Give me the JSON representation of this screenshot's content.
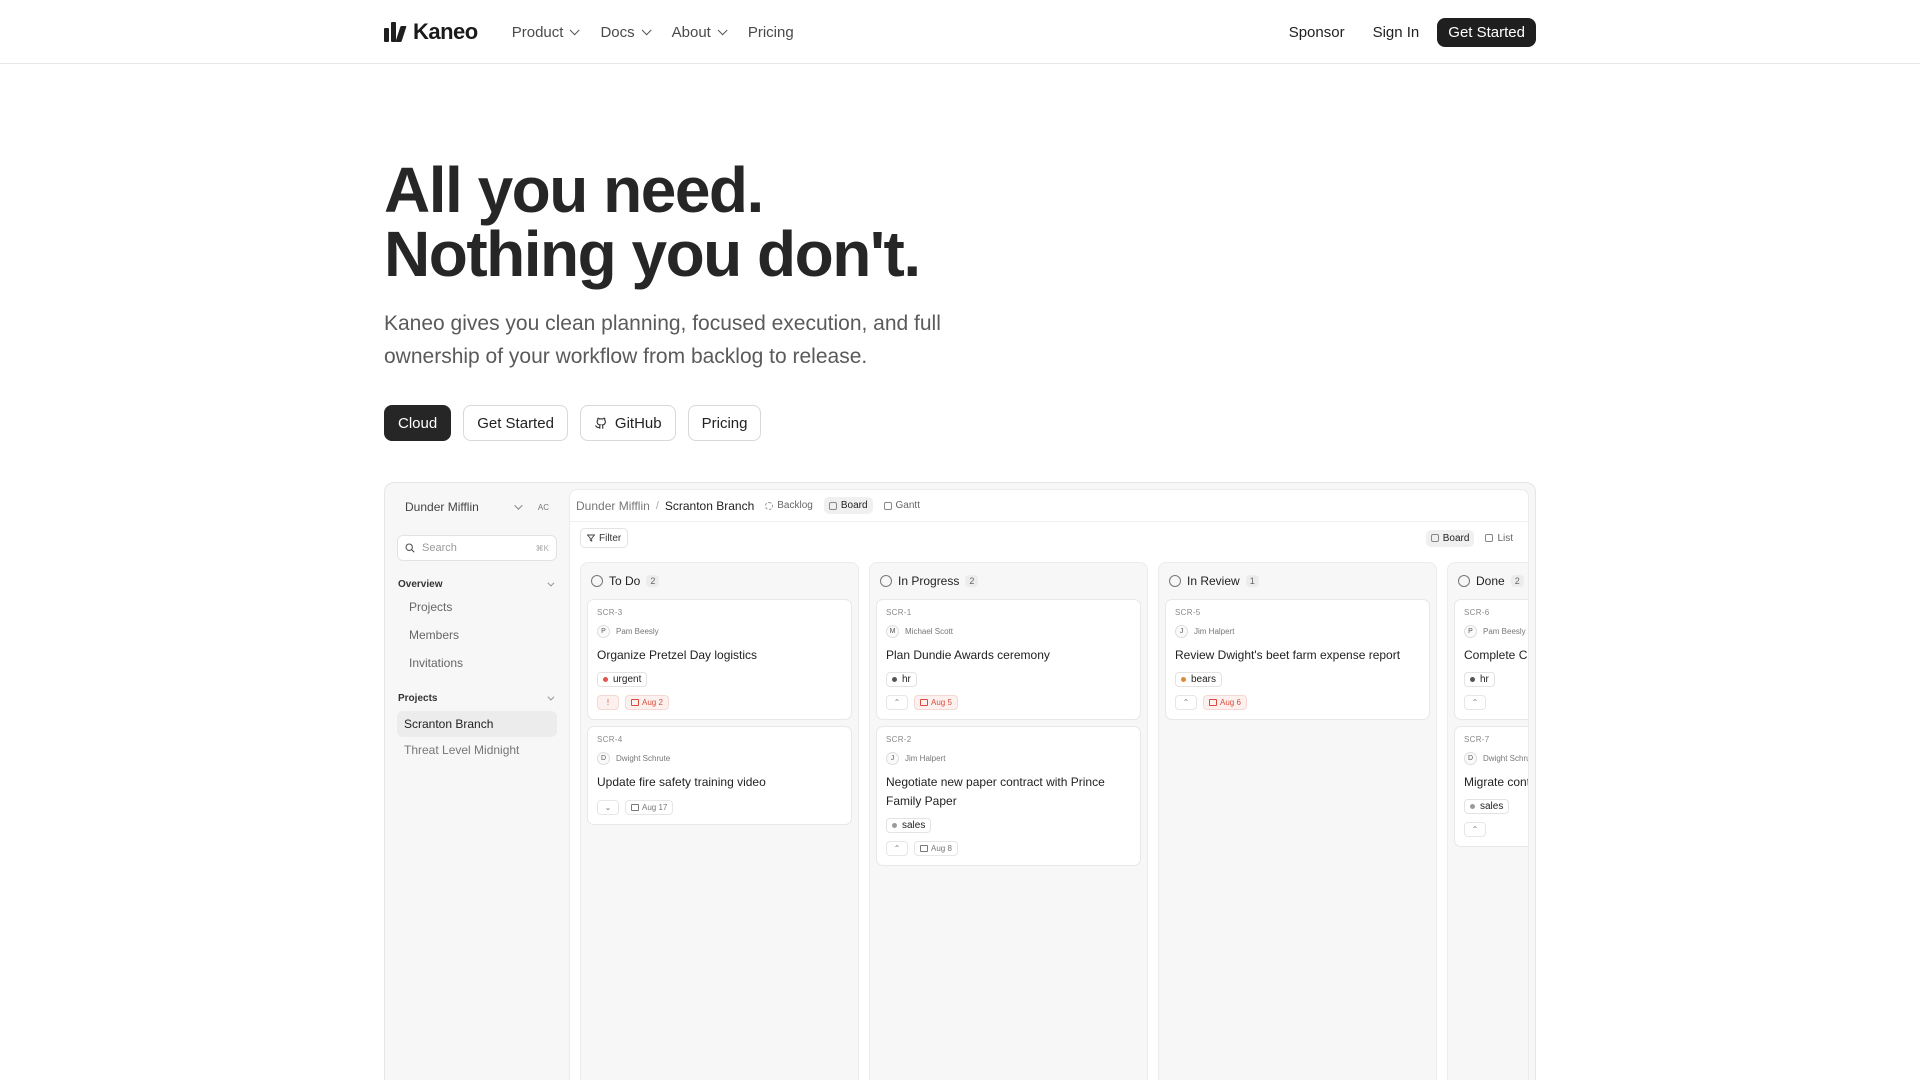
{
  "nav": {
    "brand": "Kaneo",
    "links": [
      {
        "label": "Product",
        "dropdown": true
      },
      {
        "label": "Docs",
        "dropdown": true
      },
      {
        "label": "About",
        "dropdown": true
      },
      {
        "label": "Pricing",
        "dropdown": false
      }
    ],
    "sponsor": "Sponsor",
    "sign_in": "Sign In",
    "get_started": "Get Started"
  },
  "hero": {
    "title_line1": "All you need.",
    "title_line2": "Nothing you don't.",
    "subtitle": "Kaneo gives you clean planning, focused execution, and full ownership of your workflow from backlog to release.",
    "ctas": {
      "cloud": "Cloud",
      "get_started": "Get Started",
      "github": "GitHub",
      "pricing": "Pricing"
    }
  },
  "app": {
    "workspace": "Dunder Mifflin",
    "workspace_badge": "AC",
    "search_placeholder": "Search",
    "search_shortcut": "⌘K",
    "overview_label": "Overview",
    "overview_items": [
      "Projects",
      "Members",
      "Invitations"
    ],
    "projects_label": "Projects",
    "projects": [
      "Scranton Branch",
      "Threat Level Midnight"
    ],
    "breadcrumb": {
      "workspace": "Dunder Mifflin",
      "separator": "/",
      "project": "Scranton Branch"
    },
    "view_tabs": [
      "Backlog",
      "Board",
      "Gantt"
    ],
    "filter_label": "Filter",
    "layout_toggle": [
      "Board",
      "List"
    ],
    "columns": [
      {
        "title": "To Do",
        "count": "2",
        "icon": "circle-icon",
        "cards": [
          {
            "id": "SCR-3",
            "assignee_initial": "P",
            "assignee": "Pam Beesly",
            "title": "Organize Pretzel Day logistics",
            "label": "urgent",
            "label_color": "#e5534b",
            "priority": "urgent-icon",
            "due": "Aug 2",
            "due_overdue": true
          },
          {
            "id": "SCR-4",
            "assignee_initial": "D",
            "assignee": "Dwight Schrute",
            "title": "Update fire safety training video",
            "label": "",
            "label_color": "",
            "priority": "low-icon",
            "due": "Aug 17",
            "due_overdue": false
          }
        ]
      },
      {
        "title": "In Progress",
        "count": "2",
        "icon": "progress-icon",
        "cards": [
          {
            "id": "SCR-1",
            "assignee_initial": "M",
            "assignee": "Michael Scott",
            "title": "Plan Dundie Awards ceremony",
            "label": "hr",
            "label_color": "#555555",
            "priority": "high-icon",
            "due": "Aug 5",
            "due_overdue": true
          },
          {
            "id": "SCR-2",
            "assignee_initial": "J",
            "assignee": "Jim Halpert",
            "title": "Negotiate new paper contract with Prince Family Paper",
            "label": "sales",
            "label_color": "#9a9a9a",
            "priority": "medium-icon",
            "due": "Aug 8",
            "due_overdue": false
          }
        ]
      },
      {
        "title": "In Review",
        "count": "1",
        "icon": "review-icon",
        "cards": [
          {
            "id": "SCR-5",
            "assignee_initial": "J",
            "assignee": "Jim Halpert",
            "title": "Review Dwight's beet farm expense report",
            "label": "bears",
            "label_color": "#e0893a",
            "priority": "high-icon",
            "due": "Aug 6",
            "due_overdue": true
          }
        ]
      },
      {
        "title": "Done",
        "count": "2",
        "icon": "check-circle-icon",
        "cards": [
          {
            "id": "SCR-6",
            "assignee_initial": "P",
            "assignee": "Pam Beesly",
            "title": "Complete Customer Survey",
            "label": "hr",
            "label_color": "#555555",
            "priority": "medium-icon",
            "due": "",
            "due_overdue": false
          },
          {
            "id": "SCR-7",
            "assignee_initial": "D",
            "assignee": "Dwight Schrute",
            "title": "Migrate contacts database",
            "label": "sales",
            "label_color": "#9a9a9a",
            "priority": "medium-icon",
            "due": "",
            "due_overdue": false
          }
        ]
      }
    ]
  }
}
